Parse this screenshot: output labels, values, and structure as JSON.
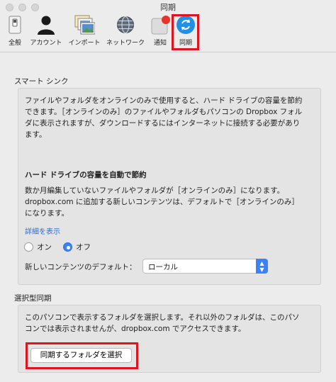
{
  "window": {
    "title": "同期"
  },
  "toolbar": {
    "items": [
      {
        "label": "全般",
        "icon": "general-switch-icon"
      },
      {
        "label": "アカウント",
        "icon": "account-person-icon"
      },
      {
        "label": "インポート",
        "icon": "import-photos-icon"
      },
      {
        "label": "ネットワーク",
        "icon": "network-globe-icon"
      },
      {
        "label": "通知",
        "icon": "notification-badge-icon"
      },
      {
        "label": "同期",
        "icon": "sync-arrows-icon"
      }
    ],
    "selected": "同期",
    "highlight_color": "#e0141e"
  },
  "smart_sync": {
    "title": "スマート シンク",
    "description_lines": [
      "ファイルやフォルダをオンラインのみで使用すると、ハード ドライブの容量を節約",
      "できます。［オンラインのみ］のファイルやフォルダもパソコンの Dropbox フォル",
      "ダに表示されますが、ダウンロードするにはインターネットに接続する必要があり",
      "ます。"
    ],
    "auto_save_heading": "ハード ドライブの容量を自動で節約",
    "auto_save_lines": [
      "数か月編集していないファイルやフォルダが［オンラインのみ］になります。",
      "dropbox.com に追加する新しいコンテンツは、デフォルトで［オンラインのみ］",
      "になります。"
    ],
    "details_link": "詳細を表示",
    "radio_on": "オン",
    "radio_off": "オフ",
    "selected_option": "オフ",
    "default_label": "新しいコンテンツのデフォルト：",
    "default_value": "ローカル"
  },
  "selective_sync": {
    "title": "選択型同期",
    "description_lines": [
      "このパソコンで表示するフォルダを選択します。それ以外のフォルダは、このパソ",
      "コンでは表示されませんが、dropbox.com でアクセスできます。"
    ],
    "button_label": "同期するフォルダを選択"
  },
  "colors": {
    "accent": "#3b82f6",
    "link": "#2a6fd6",
    "highlight": "#e0141e"
  }
}
